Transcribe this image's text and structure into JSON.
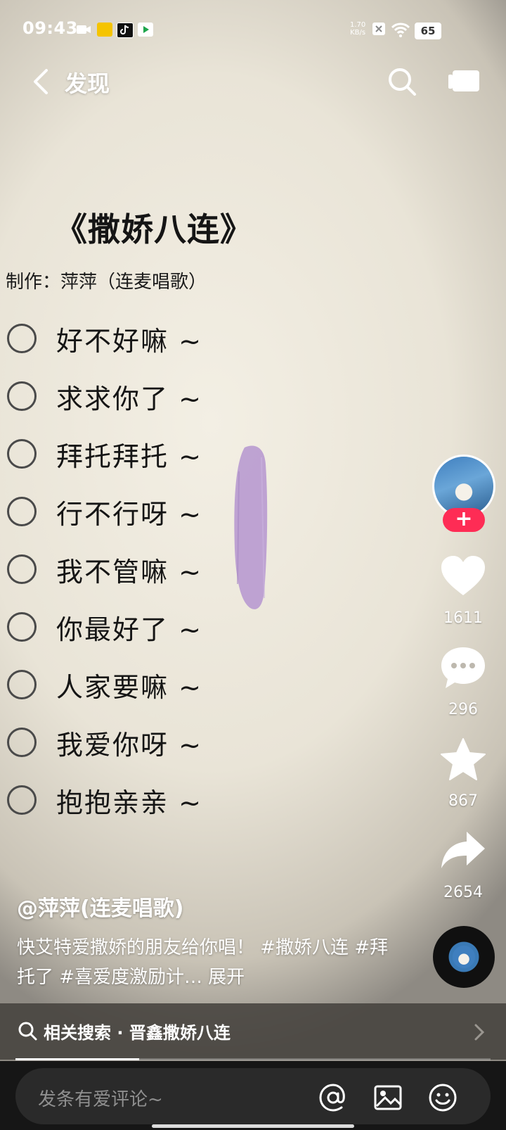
{
  "status_bar": {
    "time": "09:43",
    "net_speed_value": "1.70",
    "net_speed_unit": "KB/s",
    "battery": "65",
    "app_icons": [
      "camera-icon",
      "app-badge-icon",
      "tiktok-icon",
      "video-app-icon"
    ]
  },
  "header": {
    "back_icon": "chevron-left-icon",
    "title": "发现",
    "search_icon": "search-icon",
    "screen_icon": "tv-icon"
  },
  "video": {
    "title": "《撒娇八连》",
    "maker": "制作：萍萍（连麦唱歌）",
    "items": [
      {
        "label": "好不好嘛 ~"
      },
      {
        "label": "求求你了 ~"
      },
      {
        "label": "拜托拜托 ~"
      },
      {
        "label": "行不行呀 ~"
      },
      {
        "label": "我不管嘛 ~"
      },
      {
        "label": "你最好了 ~"
      },
      {
        "label": "人家要嘛 ~"
      },
      {
        "label": "我爱你呀 ~"
      },
      {
        "label": "抱抱亲亲 ~"
      }
    ]
  },
  "rail": {
    "follow_label": "+",
    "likes": "1611",
    "comments": "296",
    "favorites": "867",
    "shares": "2654"
  },
  "caption": {
    "author": "@萍萍(连麦唱歌)",
    "text": "快艾特爱撒娇的朋友给你唱！ #撒娇八连 #拜托了 #喜爱度激励计…",
    "more": "展开"
  },
  "related": {
    "label": "相关搜索 · 晋鑫撒娇八连"
  },
  "progress": {
    "fraction": 0.26
  },
  "comment_bar": {
    "placeholder": "发条有爱评论~"
  },
  "colors": {
    "accent": "#fe2c55",
    "brush": "#b89ad0"
  }
}
